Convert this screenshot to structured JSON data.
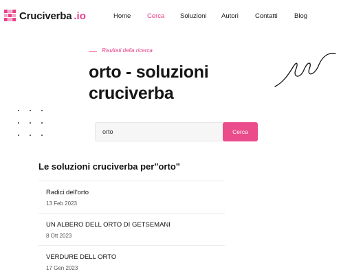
{
  "logo": {
    "name": "Cruciverba",
    "suffix": ".io"
  },
  "nav": {
    "items": [
      {
        "label": "Home",
        "active": false
      },
      {
        "label": "Cerca",
        "active": true
      },
      {
        "label": "Soluzioni",
        "active": false
      },
      {
        "label": "Autori",
        "active": false
      },
      {
        "label": "Contatti",
        "active": false
      },
      {
        "label": "Blog",
        "active": false
      }
    ]
  },
  "hero": {
    "eyebrow": "Risultati della ricerca",
    "title": "orto - soluzioni cruciverba"
  },
  "search": {
    "value": "orto",
    "button_label": "Cerca"
  },
  "results": {
    "heading": "Le soluzioni cruciverba per\"orto\"",
    "items": [
      {
        "title": "Radici dell'orto",
        "date": "13 Feb 2023"
      },
      {
        "title": "UN ALBERO DELL ORTO DI GETSEMANI",
        "date": "8 Ott 2023"
      },
      {
        "title": "VERDURE DELL ORTO",
        "date": "17 Gen 2023"
      }
    ]
  },
  "colors": {
    "accent": "#e8408a",
    "text": "#141414"
  }
}
